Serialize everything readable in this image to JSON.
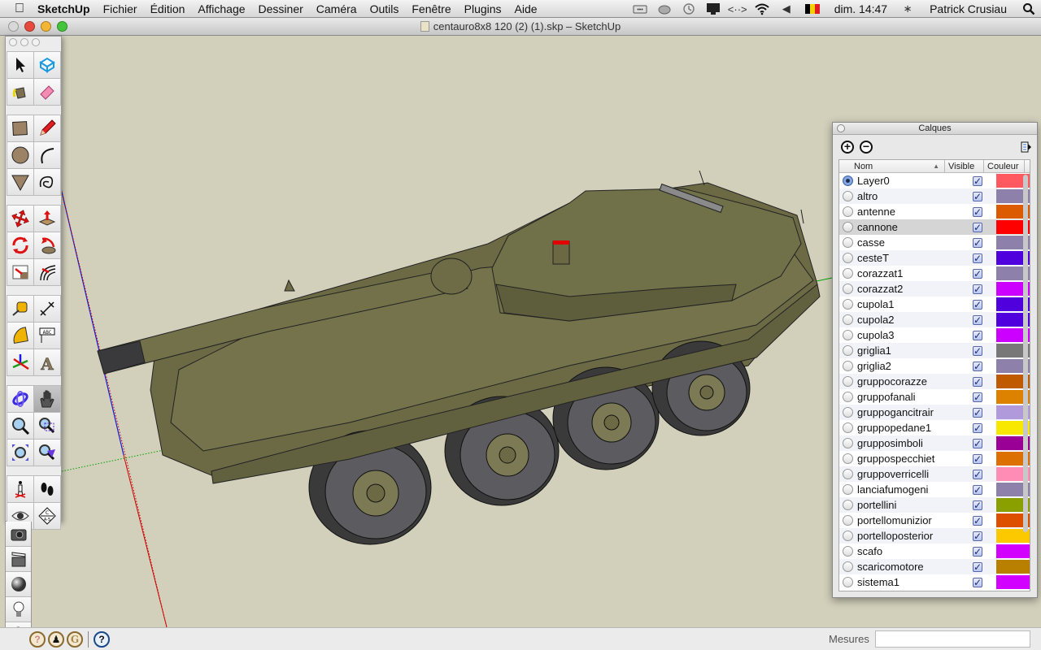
{
  "menubar": {
    "apple": "",
    "app_name": "SketchUp",
    "items": [
      "Fichier",
      "Édition",
      "Affichage",
      "Dessiner",
      "Caméra",
      "Outils",
      "Fenêtre",
      "Plugins",
      "Aide"
    ],
    "status_icons": [
      "display-mirroring-icon",
      "cloud-icon",
      "time-machine-icon",
      "monitor-icon",
      "network-arrows-icon",
      "wifi-icon",
      "volume-icon"
    ],
    "flag_colors": [
      "#000000",
      "#f5d000",
      "#e21b23"
    ],
    "clock": "dim. 14:47",
    "bluetooth": "∗",
    "user": "Patrick Crusiau",
    "spotlight": "⌕"
  },
  "window": {
    "title": "centauro8x8 120 (2) (1).skp – SketchUp",
    "traffic_lights": [
      "#e64a3e",
      "#f2b634",
      "#45c43b"
    ]
  },
  "tools": {
    "groups": [
      [
        "select",
        "make-component"
      ],
      [
        "paint-bucket",
        "eraser"
      ],
      [
        "rectangle",
        "pencil"
      ],
      [
        "circle",
        "arc"
      ],
      [
        "polygon",
        "freehand"
      ],
      [
        "move",
        "push-pull"
      ],
      [
        "rotate",
        "follow-me"
      ],
      [
        "scale",
        "offset"
      ],
      [
        "tape-measure",
        "dimension"
      ],
      [
        "protractor",
        "text"
      ],
      [
        "axes",
        "3d-text"
      ],
      [
        "orbit",
        "pan"
      ],
      [
        "zoom",
        "zoom-window"
      ],
      [
        "zoom-extents",
        "previous-view"
      ],
      [
        "position-camera",
        "walk"
      ],
      [
        "look-around",
        "section-plane"
      ]
    ],
    "active": "pan",
    "secondary": [
      "camera",
      "scenes",
      "materials",
      "shadows",
      "settings"
    ]
  },
  "statusbar": {
    "icons": [
      "geolocation-icon",
      "credits-icon",
      "google-icon",
      "help-icon"
    ],
    "measures_label": "Mesures",
    "measures_value": ""
  },
  "layers_panel": {
    "title": "Calques",
    "add_label": "+",
    "remove_label": "−",
    "columns": {
      "name": "Nom",
      "visible": "Visible",
      "color": "Couleur"
    },
    "sort_indicator": "▲",
    "check_glyph": "✓",
    "current_layer": "Layer0",
    "selected_row": "cannone",
    "layers": [
      {
        "name": "Layer0",
        "visible": true,
        "color": "#ff5a5f"
      },
      {
        "name": "altro",
        "visible": true,
        "color": "#8d80aa"
      },
      {
        "name": "antenne",
        "visible": true,
        "color": "#dc5a00"
      },
      {
        "name": "cannone",
        "visible": true,
        "color": "#ff0000"
      },
      {
        "name": "casse",
        "visible": true,
        "color": "#8d80aa"
      },
      {
        "name": "cesteT",
        "visible": true,
        "color": "#5000dc"
      },
      {
        "name": "corazzat1",
        "visible": true,
        "color": "#8d80aa"
      },
      {
        "name": "corazzat2",
        "visible": true,
        "color": "#cc00ff"
      },
      {
        "name": "cupola1",
        "visible": true,
        "color": "#5000dc"
      },
      {
        "name": "cupola2",
        "visible": true,
        "color": "#5000dc"
      },
      {
        "name": "cupola3",
        "visible": true,
        "color": "#cc00ff"
      },
      {
        "name": "griglia1",
        "visible": true,
        "color": "#787878"
      },
      {
        "name": "griglia2",
        "visible": true,
        "color": "#8d80aa"
      },
      {
        "name": "gruppocorazze",
        "visible": true,
        "color": "#c05a00"
      },
      {
        "name": "gruppofanali",
        "visible": true,
        "color": "#dc8200"
      },
      {
        "name": "gruppogancitrair",
        "visible": true,
        "color": "#b09adc"
      },
      {
        "name": "gruppopedane1",
        "visible": true,
        "color": "#f8e800"
      },
      {
        "name": "grupposimboli",
        "visible": true,
        "color": "#9a0096"
      },
      {
        "name": "gruppospecchiet",
        "visible": true,
        "color": "#dc7000"
      },
      {
        "name": "gruppoverricelli",
        "visible": true,
        "color": "#ff8cb4"
      },
      {
        "name": "lanciafumogeni",
        "visible": true,
        "color": "#8d80aa"
      },
      {
        "name": "portellini",
        "visible": true,
        "color": "#8aa000"
      },
      {
        "name": "portellomunizior",
        "visible": true,
        "color": "#dc5000"
      },
      {
        "name": "portelloposterior",
        "visible": true,
        "color": "#fcc800"
      },
      {
        "name": "scafo",
        "visible": true,
        "color": "#d200ff"
      },
      {
        "name": "scaricomotore",
        "visible": true,
        "color": "#b98000"
      },
      {
        "name": "sistema1",
        "visible": true,
        "color": "#d200ff"
      }
    ]
  },
  "viewport": {
    "background": "#d2d0bb",
    "model_color": "#6b6a45",
    "axis_colors": {
      "red": "#cc0000",
      "green": "#00aa00",
      "blue": "#0000cc"
    }
  }
}
